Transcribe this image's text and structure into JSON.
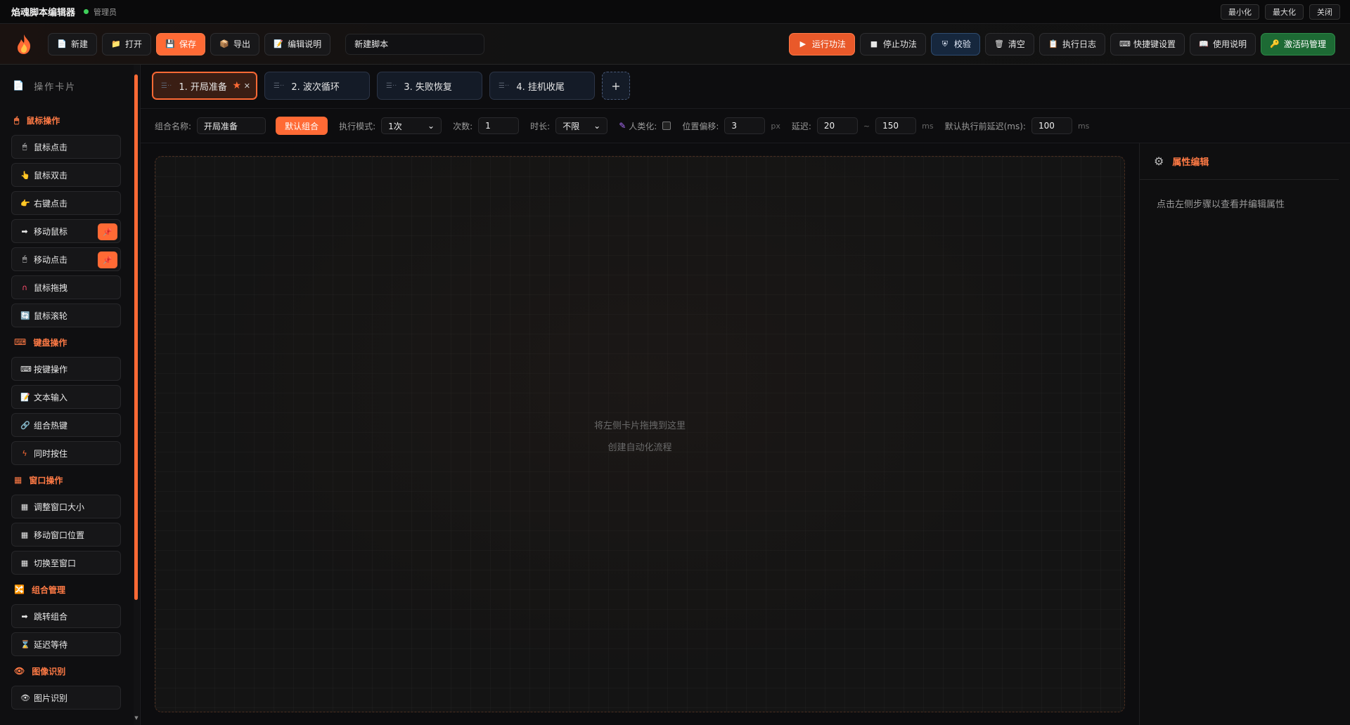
{
  "titlebar": {
    "title": "焰魂脚本编辑器",
    "role": "管理员",
    "minimize": "最小化",
    "maximize": "最大化",
    "close": "关闭"
  },
  "toolbar": {
    "new": "新建",
    "open": "打开",
    "save": "保存",
    "export": "导出",
    "edit_desc": "编辑说明",
    "script_name": "新建脚本",
    "run": "运行功法",
    "stop": "停止功法",
    "verify": "校验",
    "clear": "清空",
    "log": "执行日志",
    "hotkey": "快捷键设置",
    "help": "使用说明",
    "activate": "激活码管理"
  },
  "sidebar": {
    "header": "操作卡片",
    "sections": [
      {
        "title": "鼠标操作",
        "icon": "mouse-icon",
        "items": [
          "鼠标点击",
          "鼠标双击",
          "右键点击",
          "移动鼠标",
          "移动点击",
          "鼠标拖拽",
          "鼠标滚轮"
        ]
      },
      {
        "title": "键盘操作",
        "icon": "keyboard-icon",
        "items": [
          "按键操作",
          "文本输入",
          "组合热键",
          "同时按住"
        ]
      },
      {
        "title": "窗口操作",
        "icon": "window-icon",
        "items": [
          "调整窗口大小",
          "移动窗口位置",
          "切换至窗口"
        ]
      },
      {
        "title": "组合管理",
        "icon": "group-icon",
        "items": [
          "跳转组合",
          "延迟等待"
        ]
      },
      {
        "title": "图像识别",
        "icon": "eye-icon",
        "items": [
          "图片识别"
        ]
      }
    ]
  },
  "tabs": [
    {
      "label": "1. 开局准备"
    },
    {
      "label": "2. 波次循环"
    },
    {
      "label": "3. 失败恢复"
    },
    {
      "label": "4. 挂机收尾"
    }
  ],
  "tab_add": "+",
  "config": {
    "group_name_label": "组合名称:",
    "group_name": "开局准备",
    "default_group": "默认组合",
    "mode_label": "执行模式:",
    "mode_value": "1次",
    "count_label": "次数:",
    "count_value": "1",
    "duration_label": "时长:",
    "duration_value": "不限",
    "humanize_label": "人类化:",
    "offset_label": "位置偏移:",
    "offset_value": "3",
    "offset_unit": "px",
    "delay_label": "延迟:",
    "delay_min": "20",
    "delay_sep": "~",
    "delay_max": "150",
    "delay_unit": "ms",
    "pre_delay_label": "默认执行前延迟(ms):",
    "pre_delay_value": "100",
    "pre_delay_unit": "ms"
  },
  "canvas": {
    "hint_line1": "将左侧卡片拖拽到这里",
    "hint_line2": "创建自动化流程"
  },
  "props": {
    "title": "属性编辑",
    "hint": "点击左侧步骤以查看并编辑属性"
  },
  "colors": {
    "accent": "#ff6a35",
    "active_green": "#3ecf5a"
  }
}
